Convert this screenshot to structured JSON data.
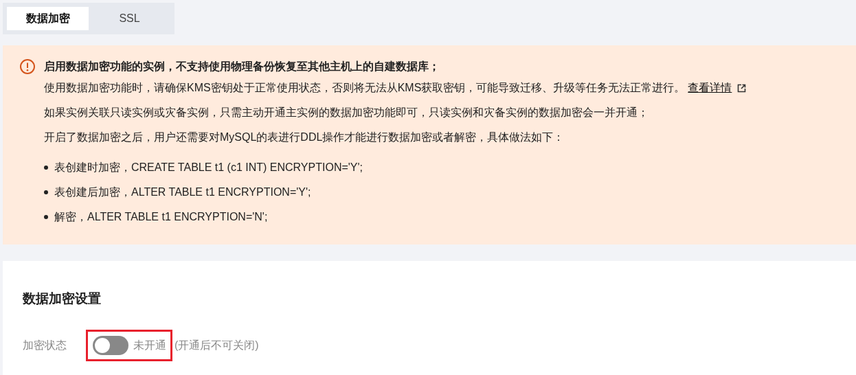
{
  "tabs": [
    {
      "label": "数据加密",
      "selected": true
    },
    {
      "label": "SSL",
      "selected": false
    }
  ],
  "alert": {
    "title": "启用数据加密功能的实例，不支持使用物理备份恢复至其他主机上的自建数据库；",
    "lines": [
      {
        "text": "使用数据加密功能时，请确保KMS密钥处于正常使用状态，否则将无法从KMS获取密钥，可能导致迁移、升级等任务无法正常进行。",
        "link": "查看详情"
      },
      {
        "text": "如果实例关联只读实例或灾备实例，只需主动开通主实例的数据加密功能即可，只读实例和灾备实例的数据加密会一并开通；"
      },
      {
        "text": "开启了数据加密之后，用户还需要对MySQL的表进行DDL操作才能进行数据加密或者解密，具体做法如下："
      }
    ],
    "bullets": [
      "表创建时加密，CREATE TABLE t1 (c1 INT) ENCRYPTION='Y';",
      "表创建后加密，ALTER TABLE t1 ENCRYPTION='Y';",
      "解密，ALTER TABLE t1 ENCRYPTION='N';"
    ]
  },
  "settings": {
    "title": "数据加密设置",
    "label": "加密状态",
    "switch": {
      "on": false,
      "highlighted": true,
      "status": "未开通",
      "note": "(开通后不可关闭)"
    }
  }
}
